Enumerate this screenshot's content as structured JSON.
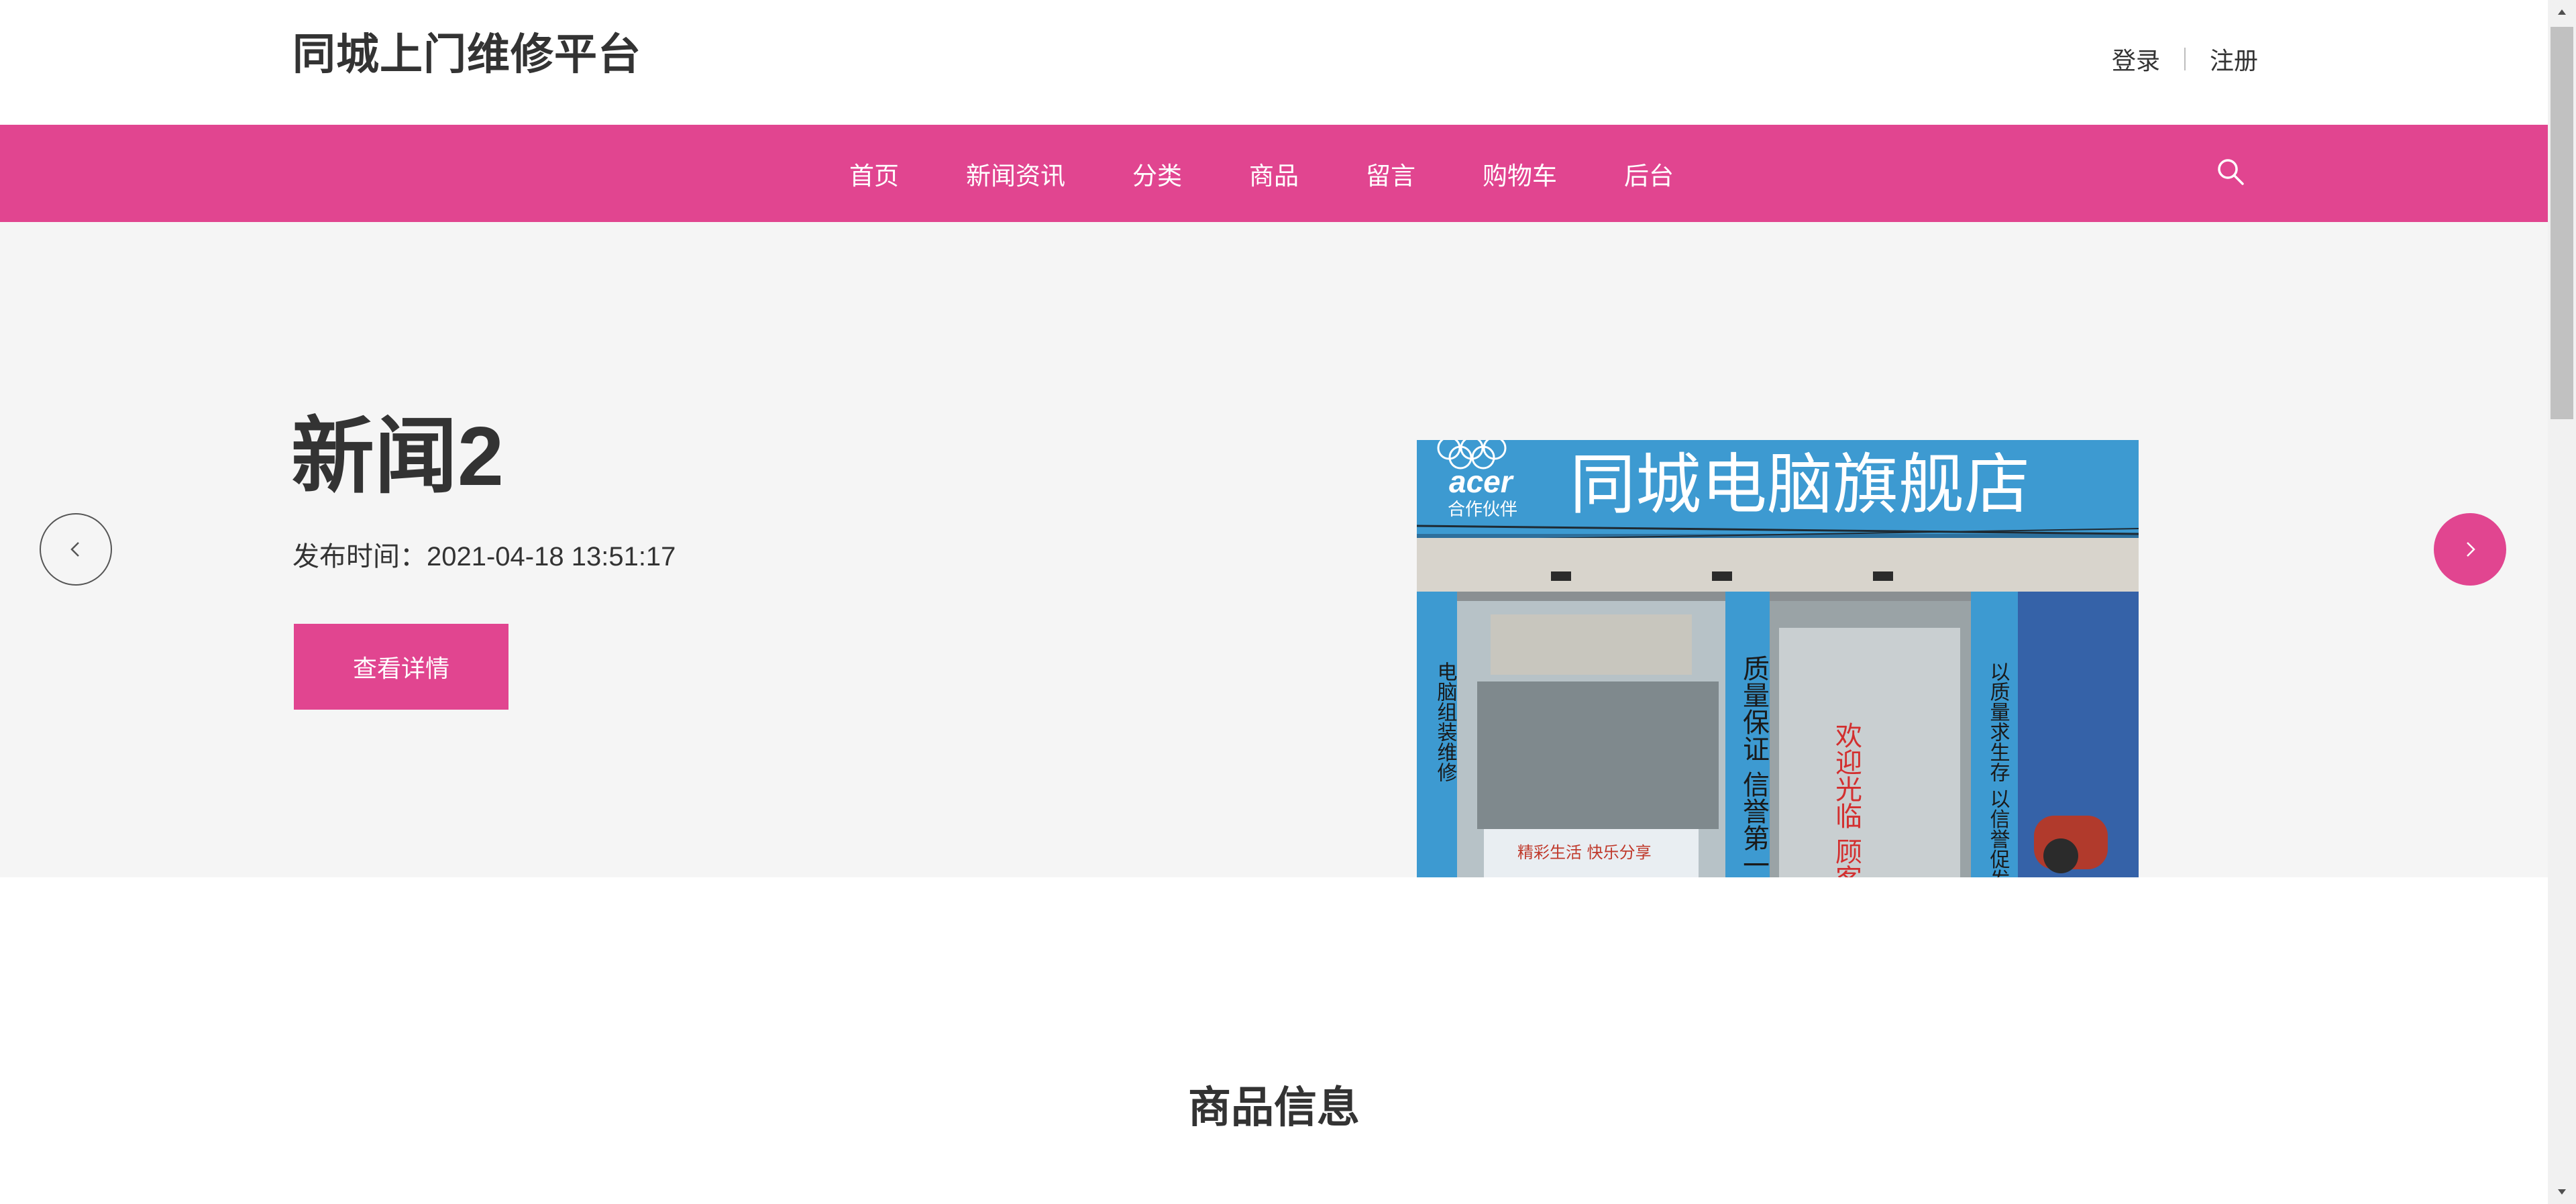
{
  "header": {
    "site_title": "同城上门维修平台",
    "login_label": "登录",
    "register_label": "注册"
  },
  "nav": {
    "items": [
      "首页",
      "新闻资讯",
      "分类",
      "商品",
      "留言",
      "购物车",
      "后台"
    ]
  },
  "banner": {
    "news_title": "新闻2",
    "publish_time": "发布时间：2021-04-18 13:51:17",
    "detail_button": "查看详情",
    "store_sign": "同城电脑旗舰店",
    "store_brand": "acer",
    "store_brand_sub": "合作伙伴",
    "store_left_pillar": "电脑组装维修",
    "store_mid_pillar": "质量保证 信誉第一",
    "store_door_text": "欢迎光临 顾客至上",
    "store_right_pillar": "以质量求生存 以信誉促发展",
    "store_poster": "精彩生活 快乐分享"
  },
  "section": {
    "products_title": "商品信息"
  },
  "colors": {
    "accent": "#e14590",
    "banner_bg": "#f5f5f5",
    "text": "#333333"
  },
  "icons": {
    "search": "search-icon",
    "prev": "chevron-left-icon",
    "next": "chevron-right-icon"
  }
}
